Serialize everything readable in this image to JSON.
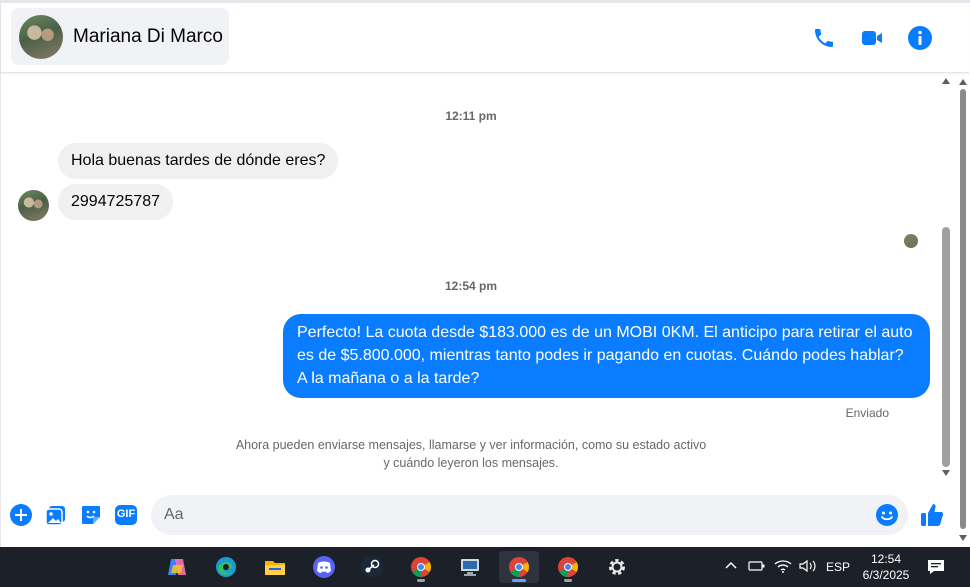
{
  "header": {
    "contact_name": "Mariana Di Marco",
    "icons": [
      "phone-icon",
      "video-camera-icon",
      "info-icon"
    ],
    "accent_color": "#0a7cff"
  },
  "thread": {
    "time_1": "12:11 pm",
    "incoming": [
      "Hola buenas tardes de dónde eres?",
      "2994725787"
    ],
    "time_2": "12:54 pm",
    "outgoing": "Perfecto! La cuota desde $183.000 es de un MOBI 0KM. El anticipo para retirar el auto es de $5.800.000, mientras tanto podes ir pagando en cuotas. Cuándo podes hablar? A la mañana o a la tarde?",
    "status": "Enviado",
    "notice": "Ahora pueden enviarse mensajes, llamarse y ver información, como su estado activo y cuándo leyeron los mensajes."
  },
  "composer": {
    "placeholder": "Aa",
    "icons": [
      "add-icon",
      "photo-icon",
      "sticker-icon",
      "gif-icon",
      "emoji-icon",
      "like-icon"
    ],
    "gif_label": "GIF"
  },
  "taskbar": {
    "apps": [
      "copilot-icon",
      "edge-icon",
      "file-explorer-icon",
      "discord-icon",
      "steam-icon",
      "chrome-icon",
      "display-settings-icon",
      "chrome-icon",
      "chrome-icon",
      "settings-icon"
    ],
    "language": "ESP",
    "time": "12:54",
    "date": "6/3/2025"
  }
}
